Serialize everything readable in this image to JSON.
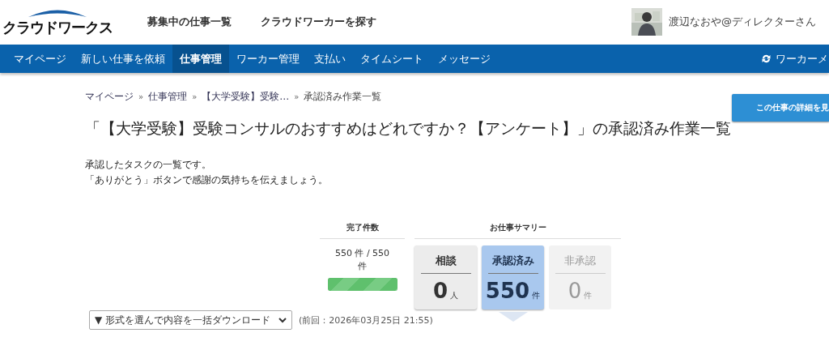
{
  "header": {
    "logo": "クラウドワークス",
    "links": [
      "募集中の仕事一覧",
      "クラウドワーカーを探す"
    ],
    "user": "渡辺なおや@ディレクターさん"
  },
  "nav": {
    "items": [
      {
        "label": "マイページ",
        "selected": false
      },
      {
        "label": "新しい仕事を依頼",
        "selected": false
      },
      {
        "label": "仕事管理",
        "selected": true
      },
      {
        "label": "ワーカー管理",
        "selected": false
      },
      {
        "label": "支払い",
        "selected": false
      },
      {
        "label": "タイムシート",
        "selected": false
      },
      {
        "label": "メッセージ",
        "selected": false
      }
    ],
    "switch": "ワーカーメ"
  },
  "breadcrumb": [
    "マイページ",
    "仕事管理",
    "【大学受験】受験…",
    "承認済み作業一覧"
  ],
  "breadcrumb_separator": "»",
  "detail_button": "この仕事の詳細を見",
  "title": "「【大学受験】受験コンサルのおすすめはどれですか？【アンケート】」の承認済み作業一覧",
  "description": [
    "承認したタスクの一覧です。",
    "「ありがとう」ボタンで感謝の気持ちを伝えましょう。"
  ],
  "completion": {
    "heading": "完了件数",
    "count": "550 件 / 550 件",
    "level": 1.0
  },
  "summary": {
    "heading": "お仕事サマリー",
    "cards": [
      {
        "label": "相談",
        "value": "0",
        "unit": "人",
        "selected": false,
        "disabled": false
      },
      {
        "label": "承認済み",
        "value": "550",
        "unit": "件",
        "selected": true,
        "disabled": false
      },
      {
        "label": "非承認",
        "value": "0",
        "unit": "件",
        "selected": false,
        "disabled": true
      }
    ]
  },
  "download": {
    "select": "▼ 形式を選んで内容を一括ダウンロード",
    "previous": "(前回：2026年03月25日 21:55)"
  }
}
